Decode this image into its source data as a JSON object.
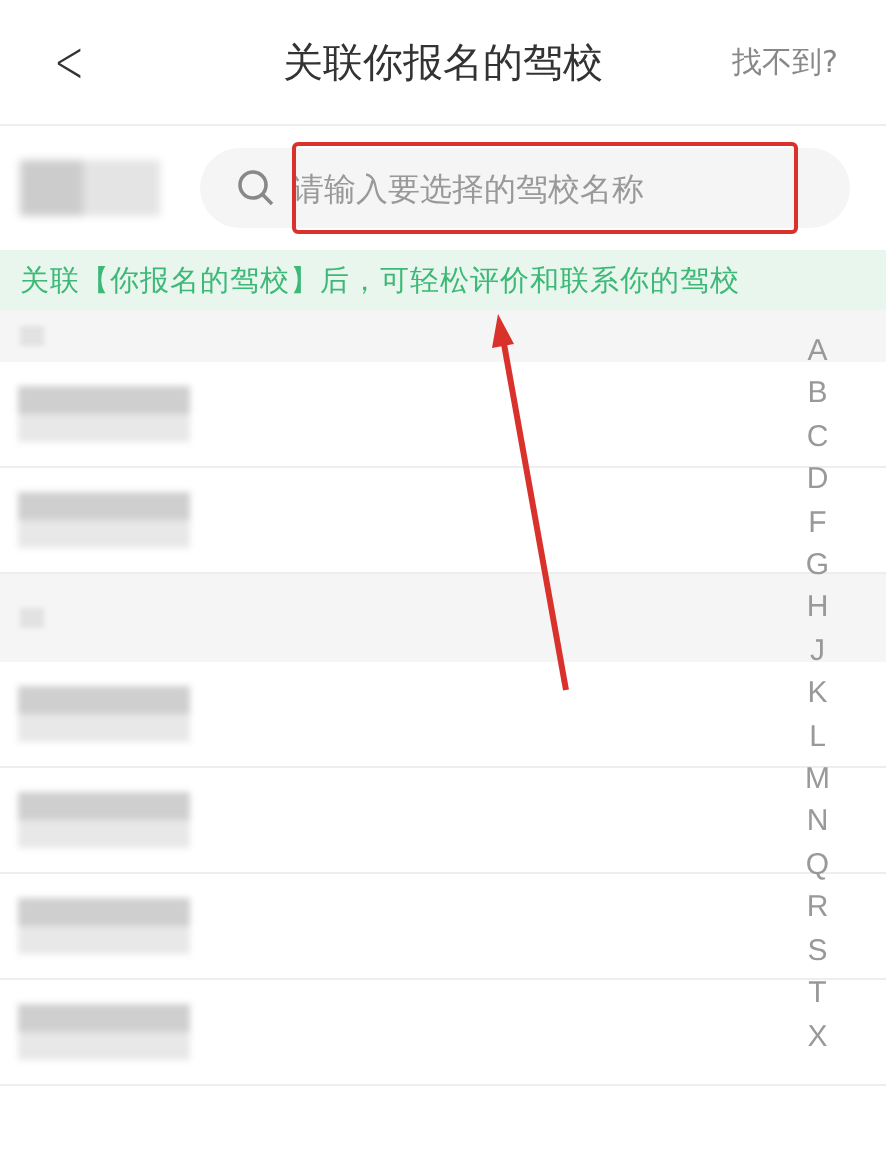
{
  "header": {
    "back": "<",
    "title": "关联你报名的驾校",
    "action": "找不到?"
  },
  "search": {
    "placeholder": "请输入要选择的驾校名称"
  },
  "notice": "关联【你报名的驾校】后，可轻松评价和联系你的驾校",
  "list": [
    {
      "kind": "section"
    },
    {
      "kind": "item"
    },
    {
      "kind": "item"
    },
    {
      "kind": "section"
    },
    {
      "kind": "item"
    },
    {
      "kind": "item"
    },
    {
      "kind": "item"
    },
    {
      "kind": "item"
    }
  ],
  "index": [
    "A",
    "B",
    "C",
    "D",
    "F",
    "G",
    "H",
    "J",
    "K",
    "L",
    "M",
    "N",
    "Q",
    "R",
    "S",
    "T",
    "X"
  ]
}
